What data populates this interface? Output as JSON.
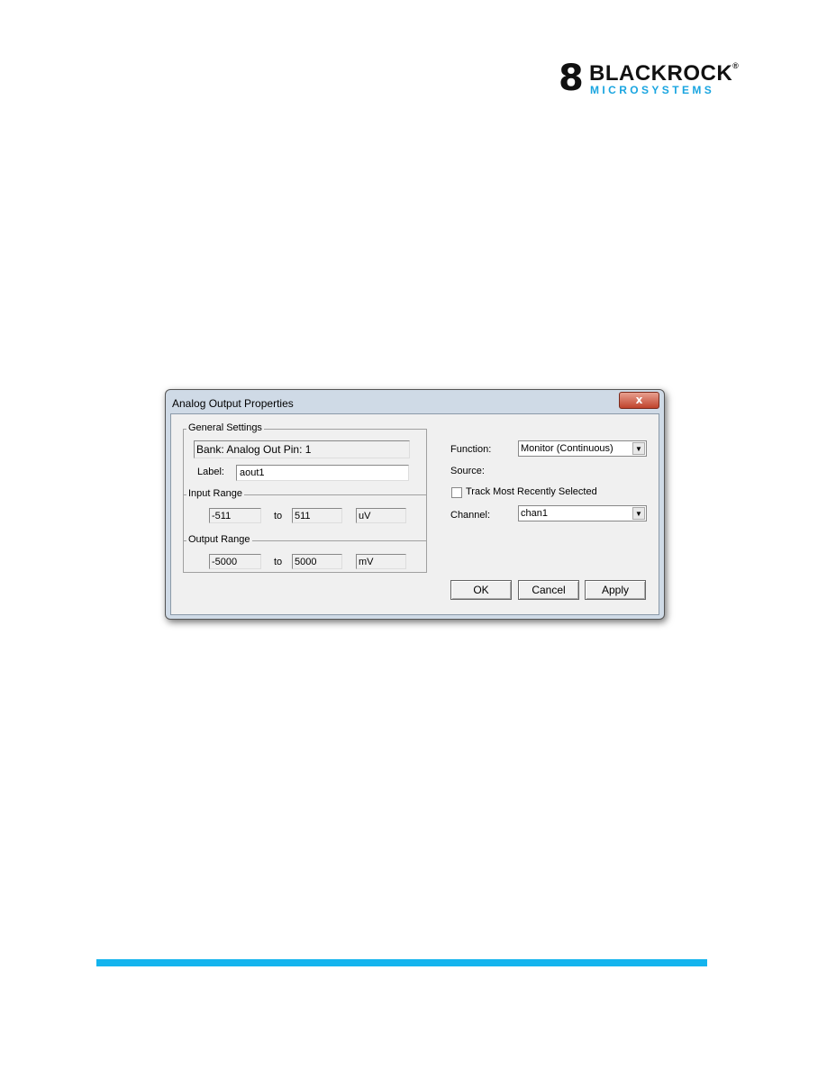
{
  "logo": {
    "name": "BLACKROCK",
    "sub": "MICROSYSTEMS",
    "registered": "®",
    "colors": {
      "text": "#111111",
      "sub": "#1aa5e0"
    }
  },
  "dialog": {
    "title": "Analog Output Properties",
    "close_label": "x",
    "general": {
      "legend": "General Settings",
      "bank": "Bank: Analog Out   Pin: 1",
      "label_label": "Label:",
      "label_value": "aout1"
    },
    "input_range": {
      "legend": "Input Range",
      "min": "-511",
      "to": "to",
      "max": "511",
      "unit": "uV"
    },
    "output_range": {
      "legend": "Output Range",
      "min": "-5000",
      "to": "to",
      "max": "5000",
      "unit": "mV"
    },
    "function": {
      "label": "Function:",
      "value": "Monitor (Continuous)"
    },
    "source": {
      "label": "Source:"
    },
    "track": {
      "label": "Track Most Recently Selected",
      "checked": false
    },
    "channel": {
      "label": "Channel:",
      "value": "chan1"
    },
    "buttons": {
      "ok": "OK",
      "cancel": "Cancel",
      "apply": "Apply"
    }
  },
  "footer": {
    "bar_color": "#14b4ee"
  }
}
